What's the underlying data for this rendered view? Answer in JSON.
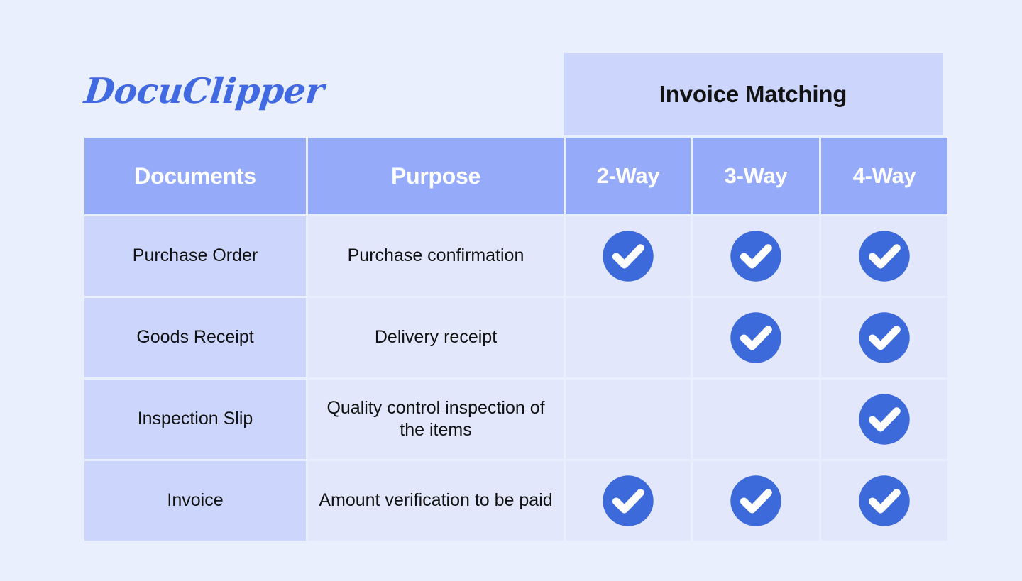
{
  "brand": {
    "logo_text": "DocuClipper",
    "logo_color": "#4169e1"
  },
  "colors": {
    "page_background": "#e9effc",
    "header_row_background": "#96aafa",
    "group_header_background": "#ccd5fb",
    "document_column_background": "#ccd5fb",
    "body_cell_background": "#e2e7fb",
    "check_circle": "#3c6ada",
    "check_mark": "#ffffff",
    "header_text": "#ffffff",
    "body_text": "#111111"
  },
  "group_header": {
    "label": "Invoice Matching",
    "spans_columns": [
      "2-Way",
      "3-Way",
      "4-Way"
    ]
  },
  "table": {
    "columns": [
      {
        "key": "documents",
        "label": "Documents"
      },
      {
        "key": "purpose",
        "label": "Purpose"
      },
      {
        "key": "two_way",
        "label": "2-Way"
      },
      {
        "key": "three_way",
        "label": "3-Way"
      },
      {
        "key": "four_way",
        "label": "4-Way"
      }
    ],
    "rows": [
      {
        "documents": "Purchase Order",
        "purpose": "Purchase confirmation",
        "two_way": true,
        "three_way": true,
        "four_way": true
      },
      {
        "documents": "Goods Receipt",
        "purpose": "Delivery receipt",
        "two_way": false,
        "three_way": true,
        "four_way": true
      },
      {
        "documents": "Inspection Slip",
        "purpose": "Quality control inspection of the items",
        "two_way": false,
        "three_way": false,
        "four_way": true
      },
      {
        "documents": "Invoice",
        "purpose": "Amount verification to be paid",
        "two_way": true,
        "three_way": true,
        "four_way": true
      }
    ]
  },
  "icons": {
    "check": "check-circle-icon"
  }
}
